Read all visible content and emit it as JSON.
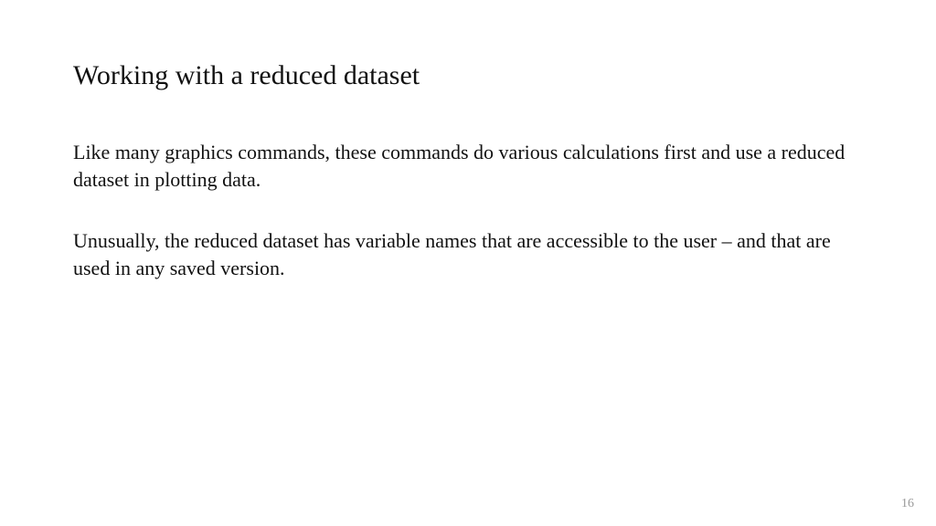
{
  "slide": {
    "title": "Working with a reduced dataset",
    "paragraph1": "Like many graphics commands, these commands do various calculations first and use a reduced dataset in plotting data.",
    "paragraph2": "Unusually, the reduced dataset has variable names that are accessible to the user – and that are used in any saved version.",
    "page_number": "16"
  }
}
